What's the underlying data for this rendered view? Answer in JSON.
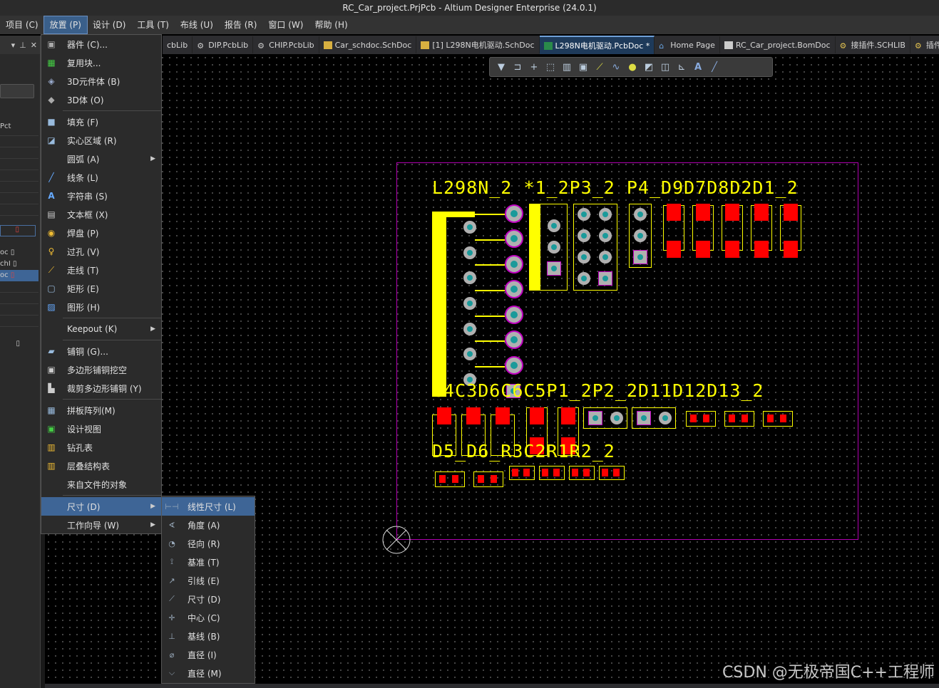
{
  "window": {
    "title": "RC_Car_project.PrjPcb - Altium Designer Enterprise (24.0.1)"
  },
  "menubar": [
    {
      "label": "项目 (C)"
    },
    {
      "label": "放置 (P)"
    },
    {
      "label": "设计 (D)"
    },
    {
      "label": "工具 (T)"
    },
    {
      "label": "布线 (U)"
    },
    {
      "label": "报告 (R)"
    },
    {
      "label": "窗口 (W)"
    },
    {
      "label": "帮助 (H)"
    }
  ],
  "tabs": [
    {
      "label": "cbLib"
    },
    {
      "label": "DIP.PcbLib"
    },
    {
      "label": "CHIP.PcbLib"
    },
    {
      "label": "Car_schdoc.SchDoc"
    },
    {
      "label": "[1] L298N电机驱动.SchDoc"
    },
    {
      "label": "L298N电机驱动.PcbDoc *"
    },
    {
      "label": "Home Page"
    },
    {
      "label": "RC_Car_project.BomDoc"
    },
    {
      "label": "接插件.SCHLIB"
    },
    {
      "label": "插件.SCHLI"
    }
  ],
  "left_panel": {
    "text1": "Pct",
    "rows": [
      "oc",
      "chI",
      "oc"
    ]
  },
  "place_menu": [
    {
      "label": "器件 (C)..."
    },
    {
      "label": "复用块..."
    },
    {
      "label": "3D元件体 (B)"
    },
    {
      "label": "3D体 (O)"
    },
    {
      "label": "填充 (F)"
    },
    {
      "label": "实心区域 (R)"
    },
    {
      "label": "圆弧 (A)"
    },
    {
      "label": "线条 (L)"
    },
    {
      "label": "字符串 (S)"
    },
    {
      "label": "文本框 (X)"
    },
    {
      "label": "焊盘 (P)"
    },
    {
      "label": "过孔 (V)"
    },
    {
      "label": "走线 (T)"
    },
    {
      "label": "矩形 (E)"
    },
    {
      "label": "图形 (H)"
    },
    {
      "label": "Keepout (K)"
    },
    {
      "label": "铺铜 (G)..."
    },
    {
      "label": "多边形铺铜挖空"
    },
    {
      "label": "裁剪多边形铺铜 (Y)"
    },
    {
      "label": "拼板阵列(M)"
    },
    {
      "label": "设计视图"
    },
    {
      "label": "钻孔表"
    },
    {
      "label": "层叠结构表"
    },
    {
      "label": "来自文件的对象"
    },
    {
      "label": "尺寸 (D)"
    },
    {
      "label": "工作向导 (W)"
    }
  ],
  "dimension_submenu": [
    {
      "label": "线性尺寸 (L)"
    },
    {
      "label": "角度 (A)"
    },
    {
      "label": "径向 (R)"
    },
    {
      "label": "基准 (T)"
    },
    {
      "label": "引线 (E)"
    },
    {
      "label": "尺寸 (D)"
    },
    {
      "label": "中心 (C)"
    },
    {
      "label": "基线 (B)"
    },
    {
      "label": "直径 (I)"
    },
    {
      "label": "直径 (M)"
    }
  ],
  "pcb_labels": {
    "row1": "L298N_2 *1_2P3_2 P4_D9D7D8D2D1_2",
    "row2": "C4C3D6C6C5P1_2P2_2D11D12D13_2",
    "row3": "D5_D6_R3C2R1R2_2"
  },
  "watermark": "CSDN @无极帝国C++工程师"
}
